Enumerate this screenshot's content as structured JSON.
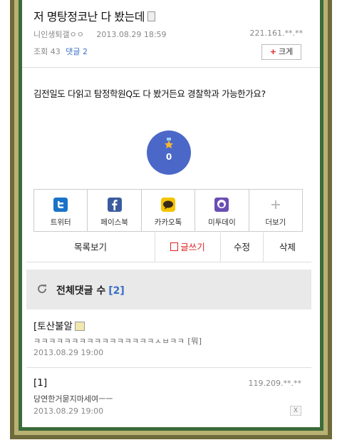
{
  "post": {
    "title": "저 명탕정코난 다 봤는데",
    "author": "니인생퇴갤ㅇㅇ",
    "datetime": "2013.08.29 18:59",
    "ip": "221.161.**.**",
    "views_label": "조회 43",
    "comments_label": "댓글 2",
    "bigger_button": "크게",
    "body": "김전일도 다읽고 탐정학원Q도 다 봤거든요 경찰학과 가능한가요?",
    "vote_count": "0"
  },
  "share": [
    {
      "label": "트위터",
      "icon": "twitter-icon",
      "color": "#1a73c9"
    },
    {
      "label": "페이스북",
      "icon": "facebook-icon",
      "color": "#3b5b9e"
    },
    {
      "label": "카카오톡",
      "icon": "kakaotalk-icon",
      "color": "#f5c400"
    },
    {
      "label": "미투데이",
      "icon": "me2day-icon",
      "color": "#6a4fb3"
    },
    {
      "label": "더보기",
      "icon": "plus-icon",
      "color": "#bbbbbb"
    }
  ],
  "actions": {
    "list": "목록보기",
    "write": "글쓰기",
    "edit": "수정",
    "delete": "삭제"
  },
  "comments_header": {
    "label": "전체댓글 수",
    "count": "[2]"
  },
  "comments": [
    {
      "author": "[토산불알",
      "text": "ㅋㅋㅋㅋㅋㅋㅋㅋㅋㅋㅋㅋㅋㅋㅋㅋㅅㅂㅋㅋ [뭐]",
      "date": "2013.08.29 19:00"
    },
    {
      "author": "[1]",
      "ip": "119.209.**.**",
      "text": "당연한거묻지마세여ㅡㅡ",
      "date": "2013.08.29 19:00",
      "close": "X"
    }
  ],
  "colors": {
    "accent_blue": "#3b6fc4",
    "vote_circle": "#4b68c8",
    "write_red": "#dd2222"
  }
}
